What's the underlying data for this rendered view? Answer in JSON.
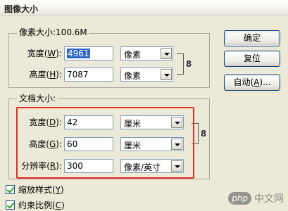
{
  "window": {
    "title": "图像大小"
  },
  "pixel_dimensions": {
    "legend": "像素大小:100.6M",
    "width": {
      "label": "宽度(",
      "key": "W",
      "suffix": "):",
      "value": "4961",
      "unit": "像素"
    },
    "height": {
      "label": "高度(",
      "key": "H",
      "suffix": "):",
      "value": "7087",
      "unit": "像素"
    }
  },
  "document_size": {
    "legend": "文档大小:",
    "width": {
      "label": "宽度(",
      "key": "D",
      "suffix": "):",
      "value": "42",
      "unit": "厘米"
    },
    "height": {
      "label": "高度(",
      "key": "G",
      "suffix": "):",
      "value": "60",
      "unit": "厘米"
    },
    "resolution": {
      "label": "分辨率(",
      "key": "R",
      "suffix": "):",
      "value": "300",
      "unit": "像素/英寸"
    }
  },
  "buttons": {
    "ok": {
      "label": "确定"
    },
    "reset": {
      "label": "复位"
    },
    "auto": {
      "label": "自动(",
      "key": "A",
      "suffix": ")..."
    }
  },
  "options": {
    "scale_styles": {
      "label": "缩放样式(",
      "key": "Y",
      "suffix": ")",
      "checked": true
    },
    "constrain": {
      "label": "约束比例(",
      "key": "C",
      "suffix": ")",
      "checked": true
    }
  },
  "watermark": {
    "logo": "php",
    "text": "中文网"
  },
  "colors": {
    "highlight": "#e0302a",
    "selection": "#316ac5",
    "dialog_bg": "#ece9d8"
  }
}
